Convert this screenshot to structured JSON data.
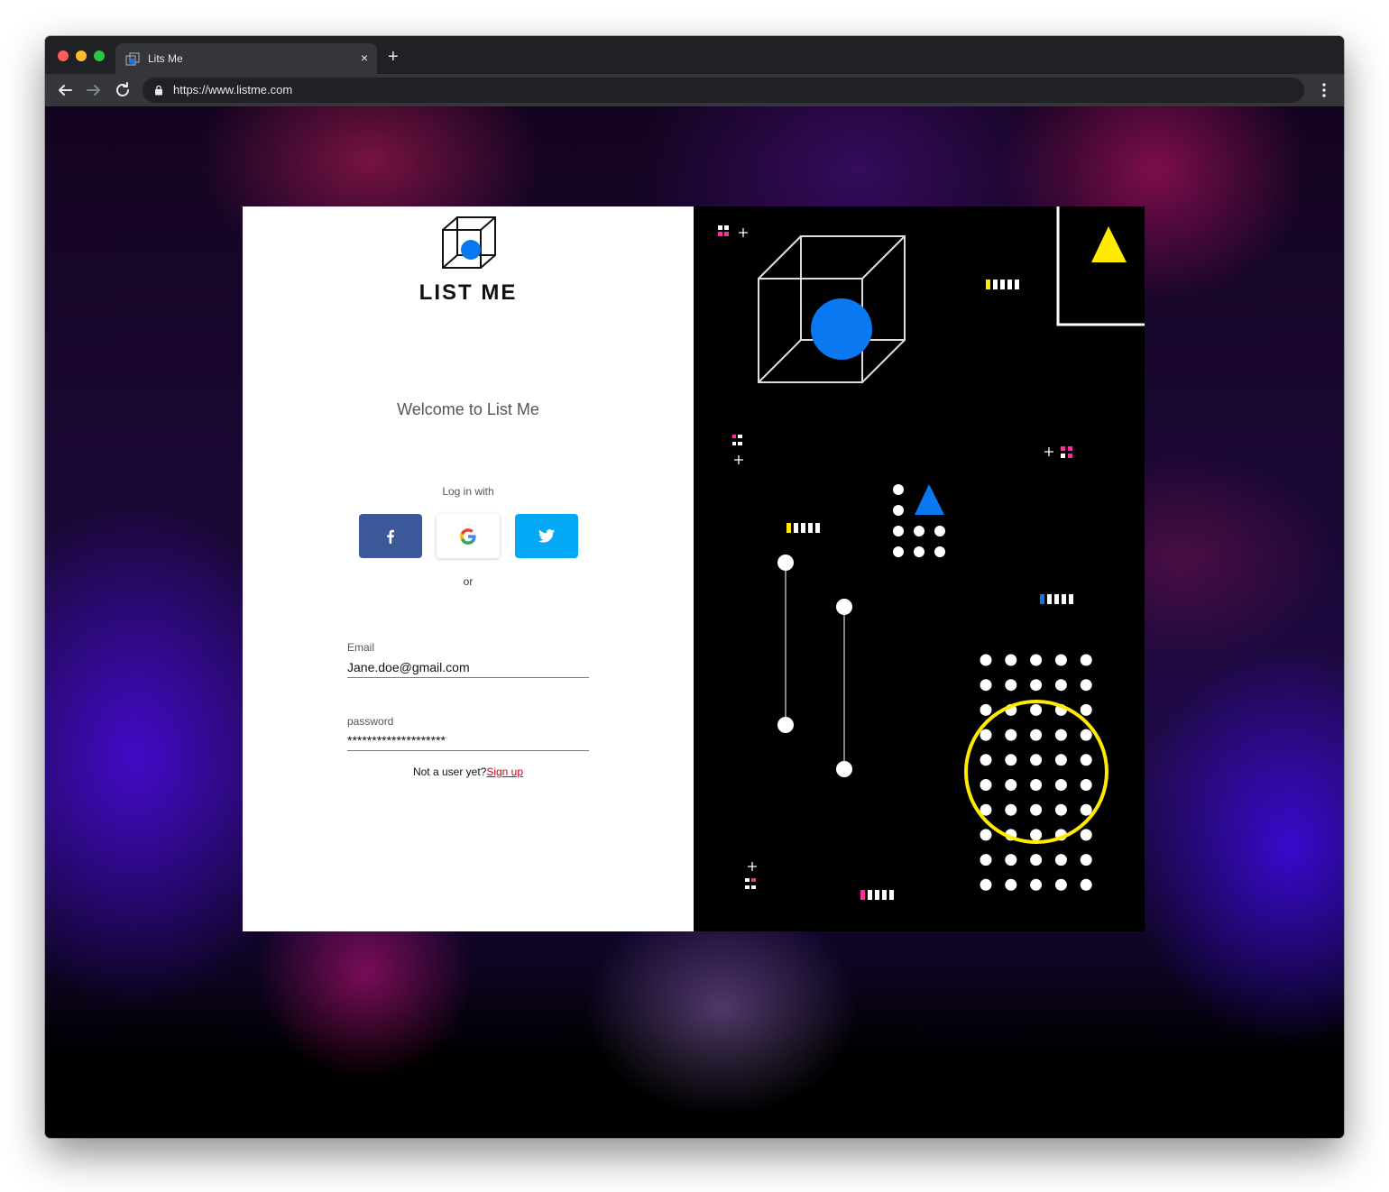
{
  "browser": {
    "tab_title": "Lits Me",
    "tab_close_icon": "×",
    "new_tab_icon": "+",
    "url": "https://www.listme.com"
  },
  "login": {
    "brand": "LIST ME",
    "welcome": "Welcome to List Me",
    "login_with": "Log in with",
    "or": "or",
    "email_label": "Email",
    "email_value": "Jane.doe@gmail.com",
    "password_label": "password",
    "password_value": "********************",
    "signup_prompt": "Not a user yet?",
    "signup_link": "Sign up"
  },
  "colors": {
    "facebook": "#3b5998",
    "twitter": "#03a9f4",
    "accent_blue": "#0a78f0",
    "accent_yellow": "#ffea00",
    "accent_pink": "#ff2d9b",
    "signup_red": "#d0021b"
  },
  "icons": {
    "facebook": "facebook-icon",
    "google": "google-icon",
    "twitter": "twitter-icon",
    "logo": "cube-logo-icon"
  }
}
